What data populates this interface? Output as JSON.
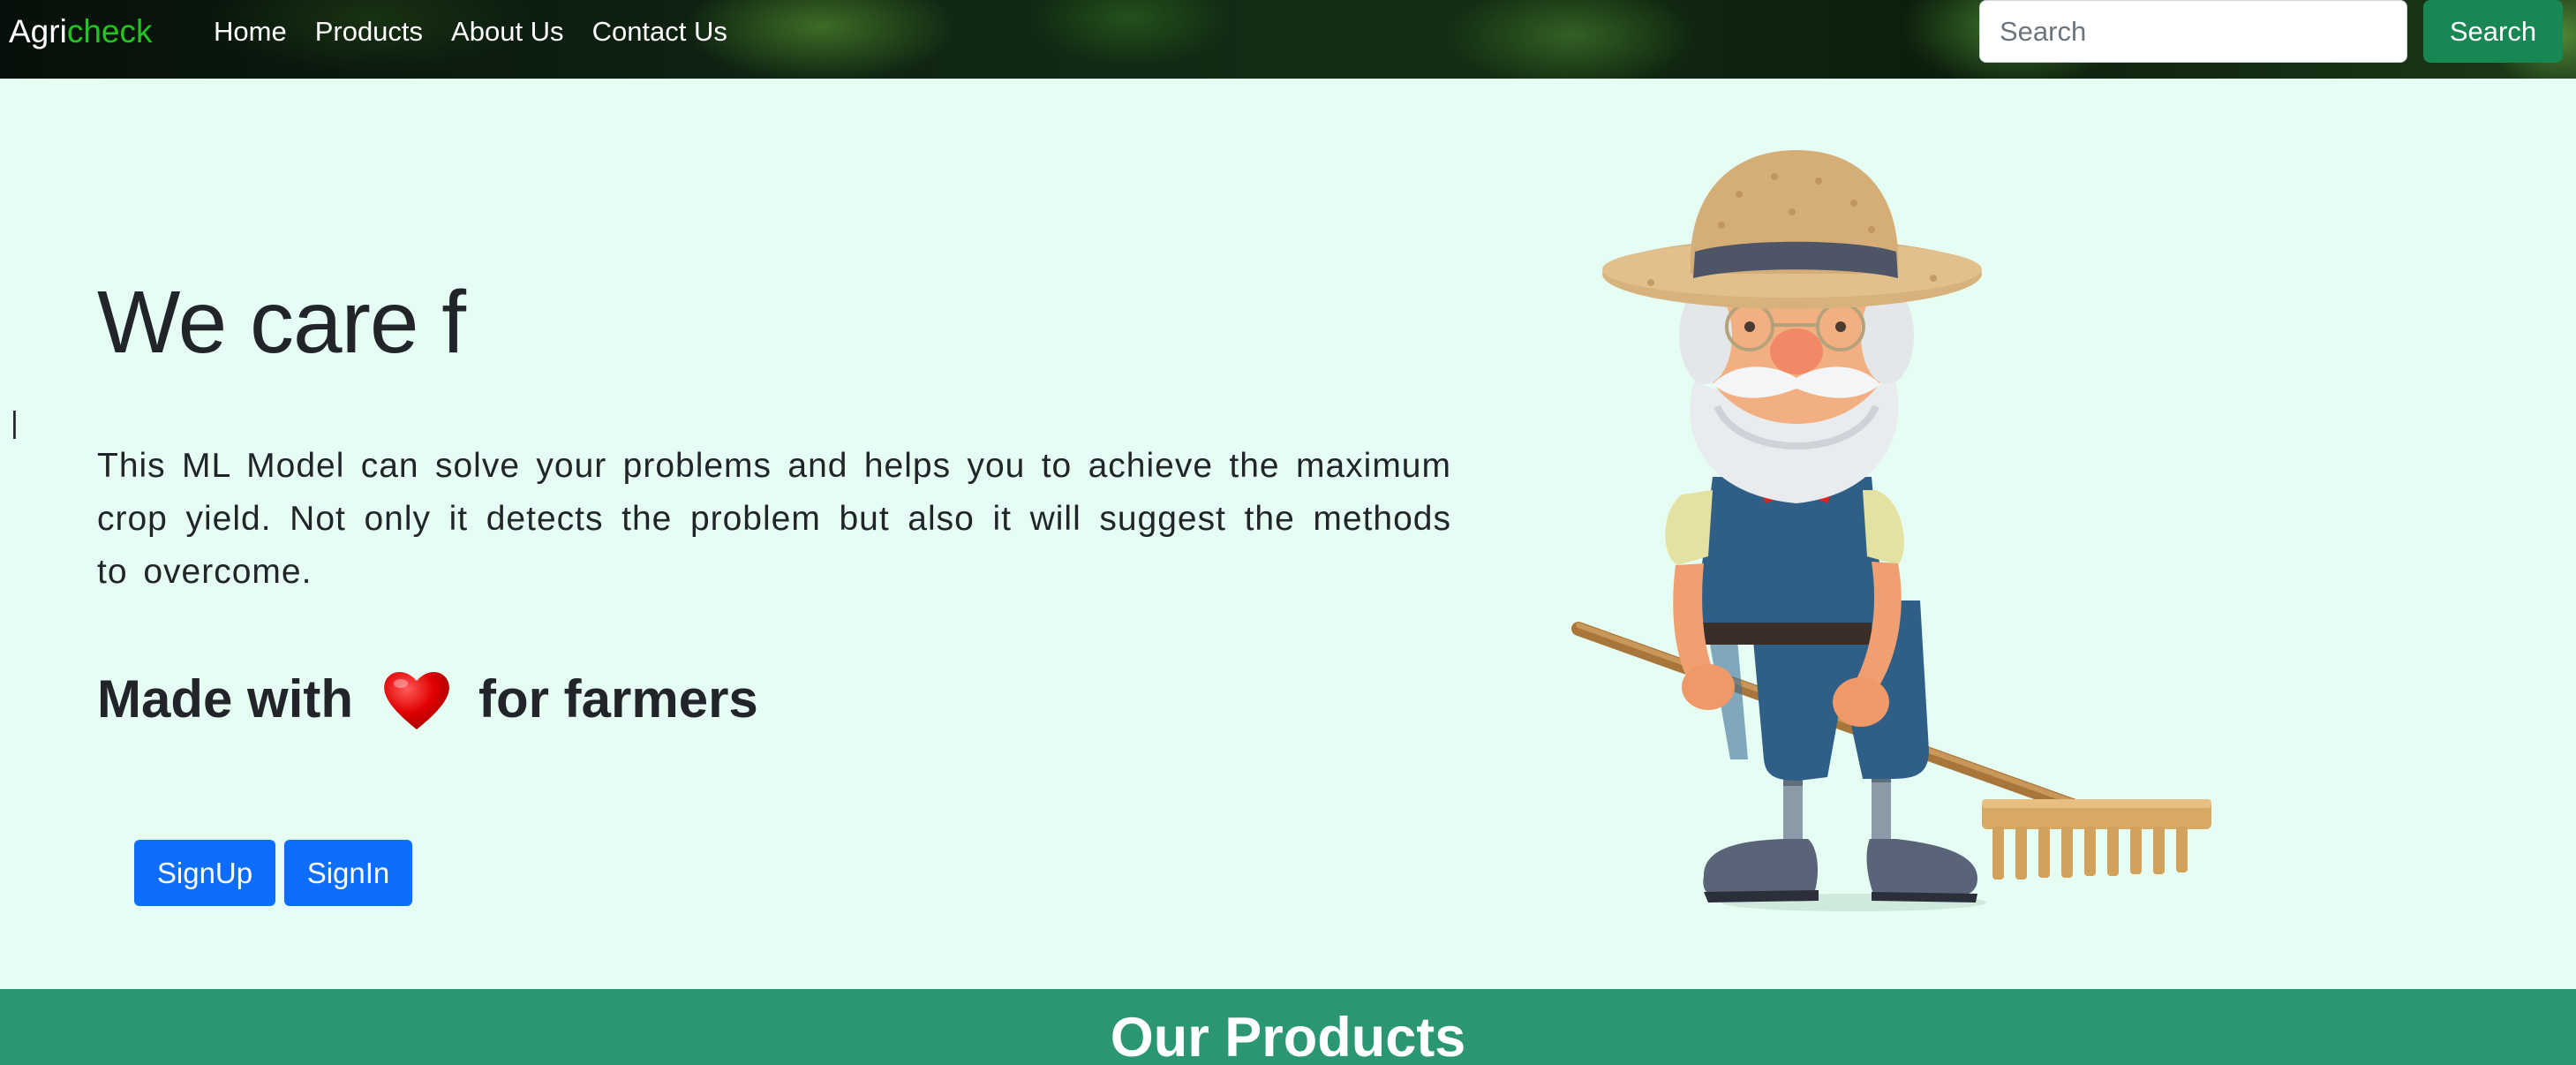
{
  "navbar": {
    "brand_part1": "Agri",
    "brand_part2": "check",
    "links": [
      "Home",
      "Products",
      "About Us",
      "Contact Us"
    ],
    "search_placeholder": "Search",
    "search_button": "Search"
  },
  "hero": {
    "caret": "|",
    "title": "We care f",
    "description": "This ML Model can solve your problems and helps you to achieve the maximum crop yield. Not only it detects the problem but also it will suggest the methods to overcome.",
    "tagline_before": "Made with",
    "tagline_icon": "heart-icon",
    "tagline_after": "for farmers",
    "signup_label": "SignUp",
    "signin_label": "SignIn",
    "illustration": "farmer-with-rake-illustration"
  },
  "products_section": {
    "title": "Our Products"
  },
  "colors": {
    "page_bg": "#e6fdf4",
    "brand_accent": "#22c41e",
    "search_button": "#198754",
    "primary_button": "#0d6efd",
    "products_banner": "#2a9770"
  }
}
